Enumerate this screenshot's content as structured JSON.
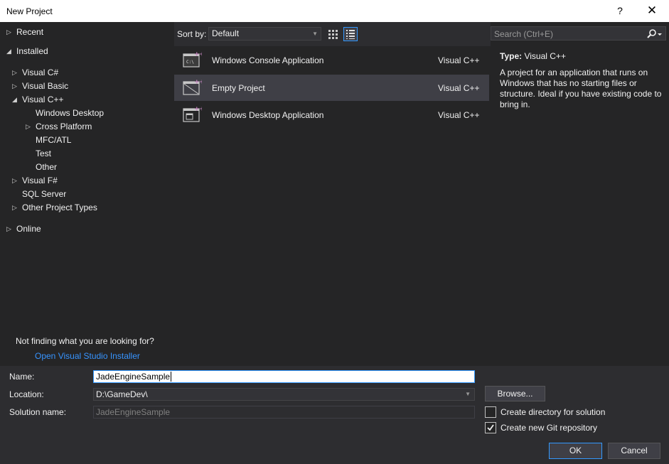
{
  "window": {
    "title": "New Project",
    "help_label": "?",
    "close_label": "✕"
  },
  "tree": {
    "recent": "Recent",
    "installed": "Installed",
    "visual_csharp": "Visual C#",
    "visual_basic": "Visual Basic",
    "visual_cpp": "Visual C++",
    "windows_desktop": "Windows Desktop",
    "cross_platform": "Cross Platform",
    "mfc_atl": "MFC/ATL",
    "test": "Test",
    "other": "Other",
    "visual_fsharp": "Visual F#",
    "sql_server": "SQL Server",
    "other_project_types": "Other Project Types",
    "online": "Online"
  },
  "left_footer": {
    "not_finding": "Not finding what you are looking for?",
    "installer_link": "Open Visual Studio Installer"
  },
  "sortbar": {
    "label": "Sort by:",
    "value": "Default"
  },
  "projects": [
    {
      "name": "Windows Console Application",
      "lang": "Visual C++",
      "icon": "console-app-icon"
    },
    {
      "name": "Empty Project",
      "lang": "Visual C++",
      "icon": "empty-project-icon"
    },
    {
      "name": "Windows Desktop Application",
      "lang": "Visual C++",
      "icon": "desktop-app-icon"
    }
  ],
  "search": {
    "placeholder": "Search (Ctrl+E)"
  },
  "details": {
    "type_label": "Type:",
    "type_value": "Visual C++",
    "description": "A project for an application that runs on Windows that has no starting files or structure. Ideal if you have existing code to bring in."
  },
  "form": {
    "name_label": "Name:",
    "name_value": "JadeEngineSample",
    "location_label": "Location:",
    "location_value": "D:\\GameDev\\",
    "solution_label": "Solution name:",
    "solution_value": "JadeEngineSample",
    "browse_label": "Browse...",
    "create_dir_label": "Create directory for solution",
    "create_dir_checked": false,
    "git_label": "Create new Git repository",
    "git_checked": true,
    "ok_label": "OK",
    "cancel_label": "Cancel"
  },
  "colors": {
    "accent": "#3399ff",
    "link": "#3794ff",
    "background": "#2d2d30",
    "panel": "#252526",
    "selection": "#3f3f46",
    "icon_purple": "#c586c0"
  }
}
